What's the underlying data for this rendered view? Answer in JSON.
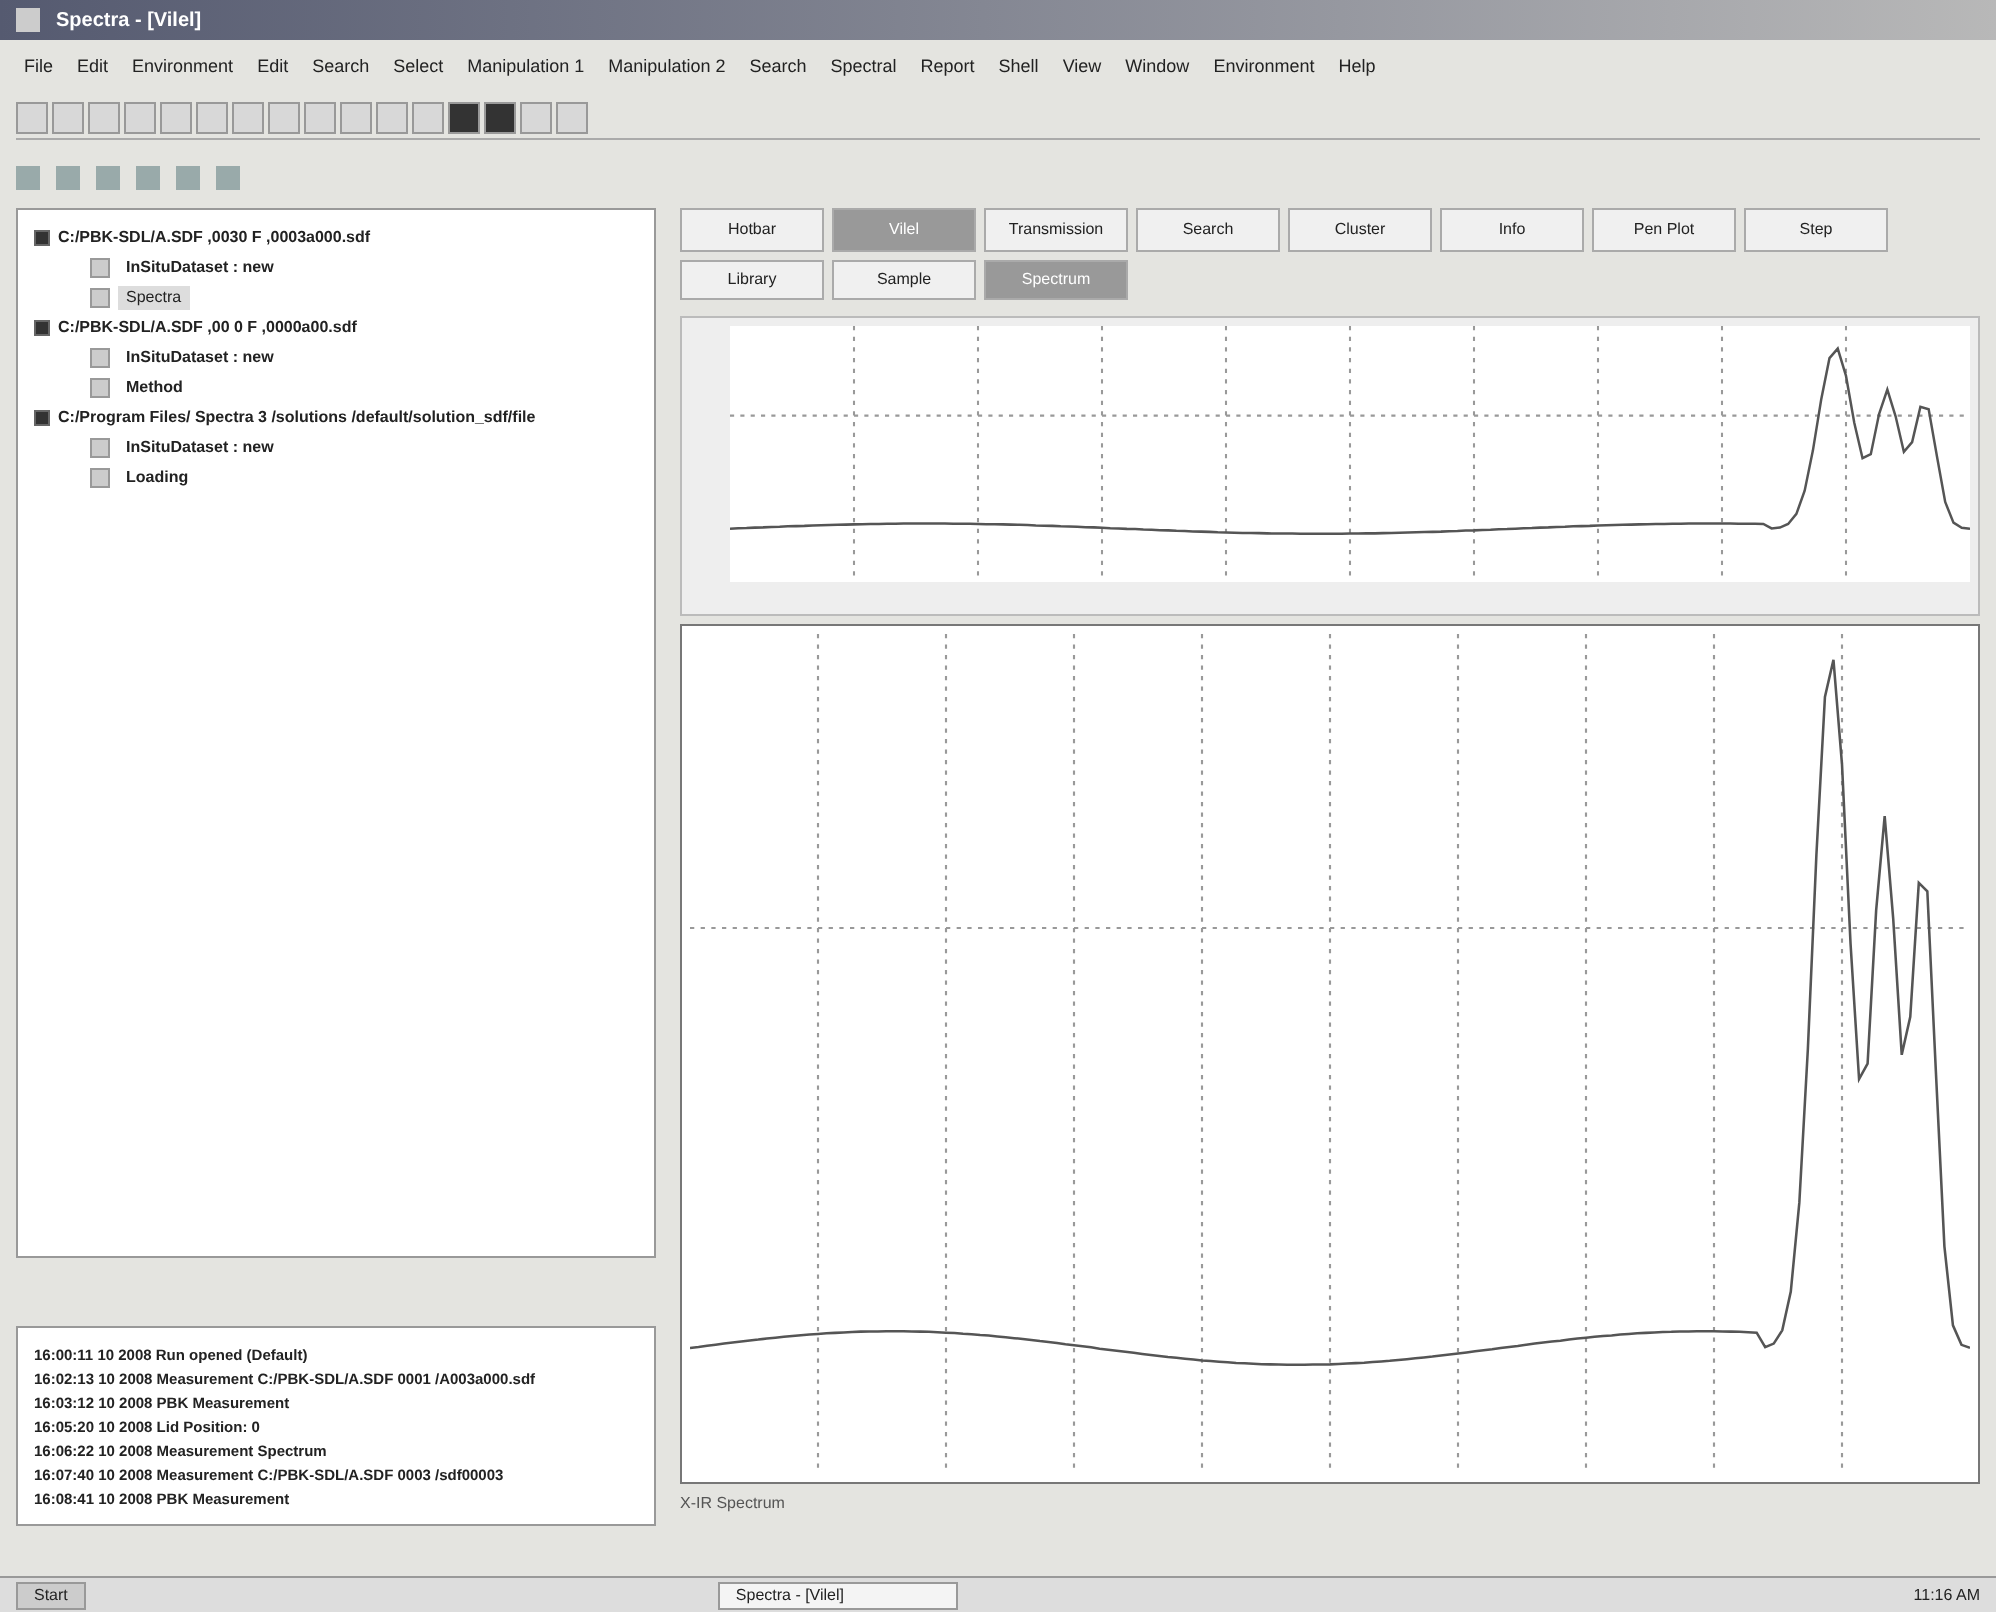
{
  "window": {
    "title": "Spectra - [Vilel]"
  },
  "menu": [
    "File",
    "Edit",
    "Environment",
    "Edit",
    "Search",
    "Select",
    "Manipulation 1",
    "Manipulation 2",
    "Search",
    "Spectral",
    "Report",
    "Shell",
    "View",
    "Window",
    "Environment",
    "Help"
  ],
  "tree": [
    {
      "label": "C:/PBK-SDL/A.SDF ,0030 F ,0003a000.sdf",
      "expanded": true,
      "children": [
        {
          "label": "InSituDataset : new"
        },
        {
          "label": "Spectra",
          "selected": true
        }
      ]
    },
    {
      "label": "C:/PBK-SDL/A.SDF ,00 0 F ,0000a00.sdf",
      "expanded": true,
      "children": [
        {
          "label": "InSituDataset : new"
        },
        {
          "label": "Method"
        }
      ]
    },
    {
      "label": "C:/Program Files/ Spectra 3 /solutions /default/solution_sdf/file",
      "expanded": true,
      "children": [
        {
          "label": "InSituDataset : new"
        },
        {
          "label": "Loading"
        }
      ]
    }
  ],
  "log": [
    "16:00:11 10 2008 Run opened (Default)",
    "16:02:13 10 2008 Measurement C:/PBK-SDL/A.SDF 0001 /A003a000.sdf",
    "16:03:12 10 2008 PBK Measurement",
    "16:05:20 10 2008 Lid Position: 0",
    "16:06:22 10 2008 Measurement Spectrum",
    "16:07:40 10 2008 Measurement C:/PBK-SDL/A.SDF 0003 /sdf00003",
    "16:08:41 10 2008 PBK Measurement"
  ],
  "tabs": [
    {
      "label": "Hotbar",
      "selected": false
    },
    {
      "label": "Vilel",
      "selected": true
    },
    {
      "label": "Transmission",
      "selected": false
    },
    {
      "label": "Search",
      "selected": false
    },
    {
      "label": "Cluster",
      "selected": false
    },
    {
      "label": "Info",
      "selected": false
    },
    {
      "label": "Pen Plot",
      "selected": false
    },
    {
      "label": "Step",
      "selected": false
    }
  ],
  "subtabs": [
    {
      "label": "Library",
      "selected": false
    },
    {
      "label": "Sample",
      "selected": false
    },
    {
      "label": "Spectrum",
      "selected": true
    }
  ],
  "chart_caption": "X-IR Spectrum",
  "taskbar": {
    "start": "Start",
    "task": "Spectra - [Vilel]",
    "clock": "11:16 AM"
  }
}
